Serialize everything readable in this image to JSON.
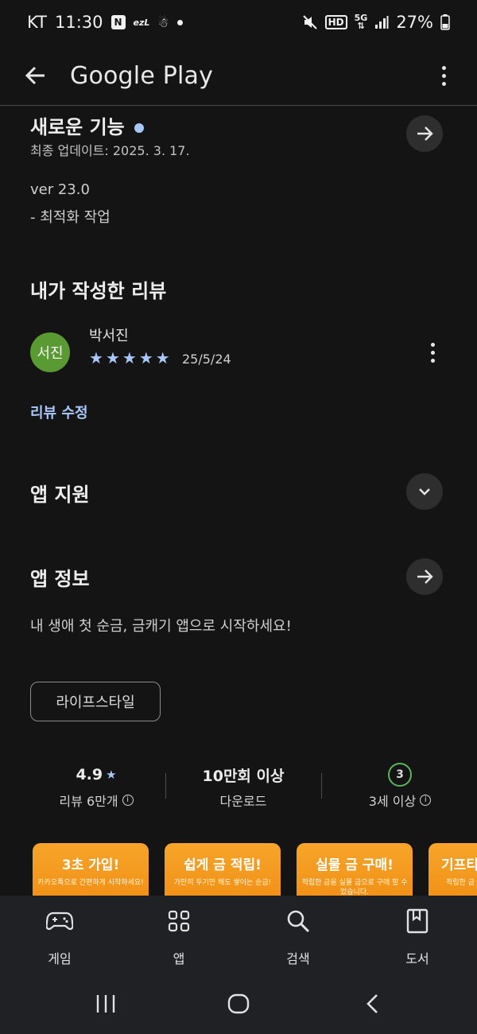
{
  "status_bar": {
    "carrier": "KT",
    "time": "11:30",
    "battery": "27%",
    "icons": [
      "naver-icon",
      "ezl-icon",
      "snowman-icon",
      "dot-icon",
      "mute-icon",
      "hd-icon",
      "5g-icon",
      "signal-icon",
      "battery-icon"
    ]
  },
  "app_bar": {
    "title": "Google Play",
    "back_icon": "arrow-left-icon",
    "more_icon": "more-vertical-icon"
  },
  "whats_new": {
    "title": "새로운 기능",
    "updated": "최종 업데이트: 2025. 3. 17.",
    "version": "ver 23.0",
    "notes": "- 최적화 작업"
  },
  "my_review": {
    "title": "내가 작성한 리뷰",
    "avatar_text": "서진",
    "avatar_color": "#5a9a33",
    "author": "박서진",
    "rating": 5,
    "date": "25/5/24",
    "edit_label": "리뷰 수정"
  },
  "app_support": {
    "title": "앱 지원"
  },
  "app_info": {
    "title": "앱 정보",
    "description": "내 생애 첫 순금, 금캐기 앱으로 시작하세요!",
    "category": "라이프스타일"
  },
  "stats": {
    "rating": "4.9",
    "reviews": "리뷰 6만개",
    "downloads": "10만회 이상",
    "downloads_label": "다운로드",
    "age_badge": "3",
    "age_label": "3세 이상"
  },
  "screenshots": [
    {
      "title": "3초 가입!",
      "subtitle": "카카오톡으로 간편하게 시작하세요!"
    },
    {
      "title": "쉽게 금 적립!",
      "subtitle": "가만히 두기만 해도 쌓이는 순금!"
    },
    {
      "title": "실물 금 구매!",
      "subtitle": "적립한 금을 실물 금으로 구매 할 수 있습니다."
    },
    {
      "title": "기프티",
      "subtitle": "적립한 금 기프티콘"
    }
  ],
  "bottom_nav": [
    {
      "label": "게임",
      "icon": "gamepad-icon"
    },
    {
      "label": "앱",
      "icon": "apps-grid-icon"
    },
    {
      "label": "검색",
      "icon": "search-icon"
    },
    {
      "label": "도서",
      "icon": "book-icon"
    }
  ],
  "colors": {
    "background": "#141414",
    "accent": "#a8c7fa",
    "screenshot_orange": "#f6a52a",
    "age_green": "#5bb35b"
  }
}
